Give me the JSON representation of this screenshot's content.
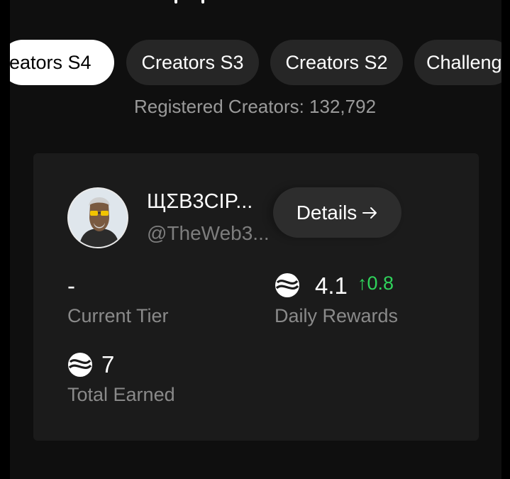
{
  "header": {
    "partial_glyph_icon": "truncated-title-glyph"
  },
  "tabs": [
    {
      "label": "reators S4",
      "active": true
    },
    {
      "label": "Creators S3",
      "active": false
    },
    {
      "label": "Creators S2",
      "active": false
    },
    {
      "label": "Challeng",
      "active": false
    }
  ],
  "registered": "Registered Creators: 132,792",
  "profile": {
    "name": "ЩΣB3CIP...",
    "handle": "@TheWeb3...",
    "details_label": "Details",
    "details_icon": "arrow-right-icon"
  },
  "stats": {
    "current_tier": {
      "value": "-",
      "label": "Current Tier"
    },
    "daily_rewards": {
      "value": "4.1",
      "delta": "0.8",
      "label": "Daily Rewards",
      "icon": "token-coin-icon"
    },
    "total_earned": {
      "value": "7",
      "label": "Total Earned",
      "icon": "token-coin-icon"
    }
  },
  "colors": {
    "accent_positive": "#2fd35b",
    "active_tab_bg": "#ffffff",
    "card_bg": "#1b1b1b"
  }
}
